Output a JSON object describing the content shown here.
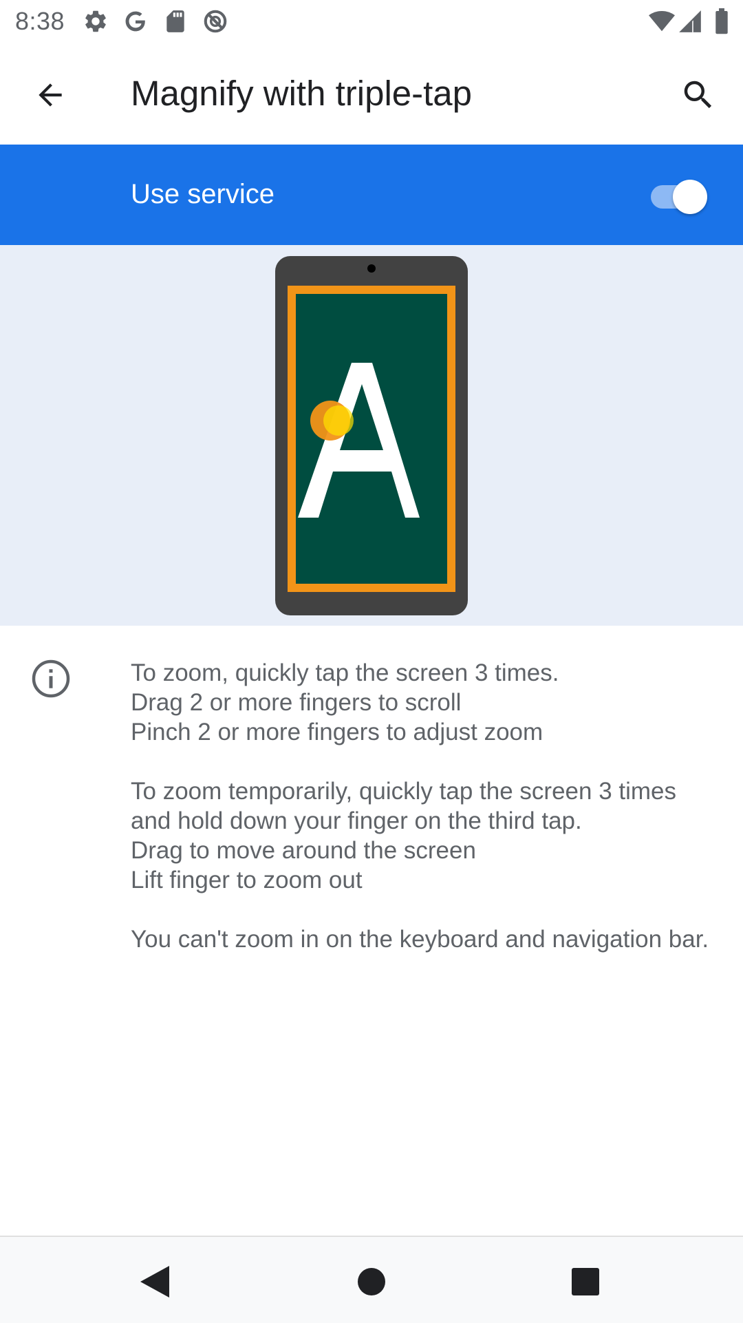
{
  "status_bar": {
    "time": "8:38",
    "left_icons": [
      "settings-icon",
      "google-icon",
      "sd-card-icon",
      "do-not-disturb-icon"
    ],
    "right_icons": [
      "wifi-icon",
      "cellular-signal-icon",
      "battery-icon"
    ]
  },
  "app_bar": {
    "title": "Magnify with triple-tap",
    "back_icon": "arrow-back-icon",
    "search_icon": "search-icon"
  },
  "master_switch": {
    "label": "Use service",
    "checked": true
  },
  "illustration": {
    "letter": "A",
    "colors": {
      "background": "#e8eef8",
      "phone_body": "#424242",
      "screen": "#004d40",
      "frame": "#f29418",
      "touch_dot": "#f5b400"
    }
  },
  "info": {
    "icon": "info-icon",
    "paragraphs": [
      "To zoom, quickly tap the screen 3 times.\nDrag 2 or more fingers to scroll\nPinch 2 or more fingers to adjust zoom",
      "To zoom temporarily, quickly tap the screen 3 times and hold down your finger on the third tap.\nDrag to move around the screen\nLift finger to zoom out",
      "You can't zoom in on the keyboard and navigation bar."
    ]
  },
  "nav_bar": {
    "back": "nav-back-icon",
    "home": "nav-home-icon",
    "recents": "nav-recents-icon"
  },
  "colors": {
    "accent": "#1a73e8",
    "text_primary": "#202124",
    "text_secondary": "#5f6368"
  }
}
